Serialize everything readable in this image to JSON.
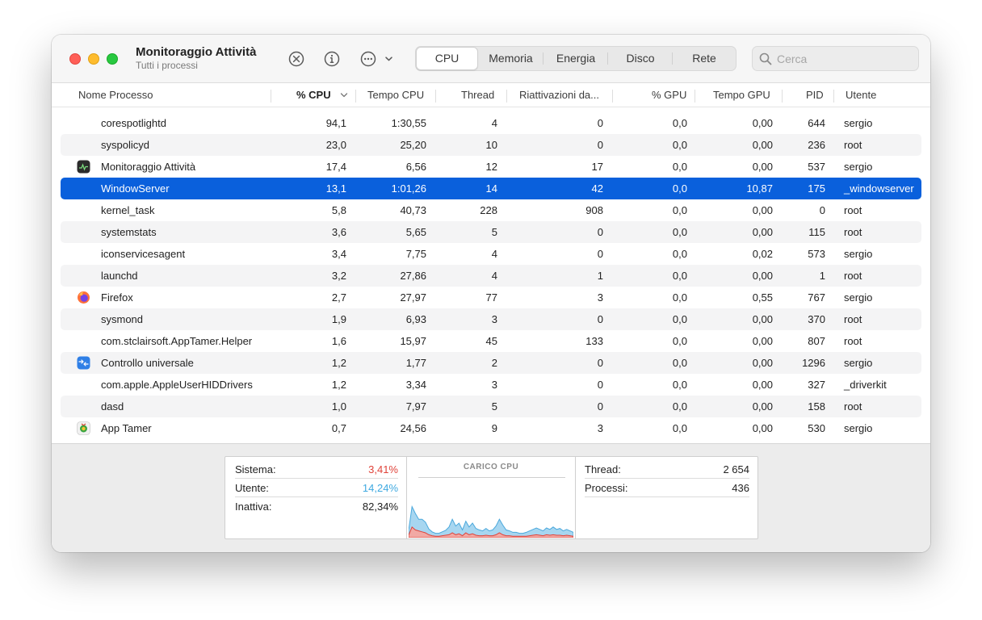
{
  "window": {
    "title": "Monitoraggio Attività",
    "subtitle": "Tutti i processi"
  },
  "toolbar": {
    "icons": [
      "stop-process-icon",
      "info-icon",
      "more-options-icon",
      "chevron-down-icon"
    ],
    "tabs": [
      {
        "label": "CPU",
        "active": true
      },
      {
        "label": "Memoria",
        "active": false
      },
      {
        "label": "Energia",
        "active": false
      },
      {
        "label": "Disco",
        "active": false
      },
      {
        "label": "Rete",
        "active": false
      }
    ],
    "search_placeholder": "Cerca"
  },
  "columns": {
    "name": "Nome Processo",
    "cpu": "% CPU",
    "cpu_time": "Tempo CPU",
    "threads": "Thread",
    "wakeups": "Riattivazioni da...",
    "gpu": "% GPU",
    "gpu_time": "Tempo GPU",
    "pid": "PID",
    "user": "Utente"
  },
  "sort": {
    "column": "% CPU",
    "direction": "descending"
  },
  "processes": [
    {
      "name": "corespotlightd",
      "cpu": "94,1",
      "cpu_time": "1:30,55",
      "threads": "4",
      "wakeups": "0",
      "gpu": "0,0",
      "gpu_time": "0,00",
      "pid": "644",
      "user": "sergio",
      "icon": ""
    },
    {
      "name": "syspolicyd",
      "cpu": "23,0",
      "cpu_time": "25,20",
      "threads": "10",
      "wakeups": "0",
      "gpu": "0,0",
      "gpu_time": "0,00",
      "pid": "236",
      "user": "root",
      "icon": ""
    },
    {
      "name": "Monitoraggio Attività",
      "cpu": "17,4",
      "cpu_time": "6,56",
      "threads": "12",
      "wakeups": "17",
      "gpu": "0,0",
      "gpu_time": "0,00",
      "pid": "537",
      "user": "sergio",
      "icon": "activity-monitor-icon"
    },
    {
      "name": "WindowServer",
      "cpu": "13,1",
      "cpu_time": "1:01,26",
      "threads": "14",
      "wakeups": "42",
      "gpu": "0,0",
      "gpu_time": "10,87",
      "pid": "175",
      "user": "_windowserver",
      "icon": "",
      "selected": true
    },
    {
      "name": "kernel_task",
      "cpu": "5,8",
      "cpu_time": "40,73",
      "threads": "228",
      "wakeups": "908",
      "gpu": "0,0",
      "gpu_time": "0,00",
      "pid": "0",
      "user": "root",
      "icon": ""
    },
    {
      "name": "systemstats",
      "cpu": "3,6",
      "cpu_time": "5,65",
      "threads": "5",
      "wakeups": "0",
      "gpu": "0,0",
      "gpu_time": "0,00",
      "pid": "115",
      "user": "root",
      "icon": ""
    },
    {
      "name": "iconservicesagent",
      "cpu": "3,4",
      "cpu_time": "7,75",
      "threads": "4",
      "wakeups": "0",
      "gpu": "0,0",
      "gpu_time": "0,02",
      "pid": "573",
      "user": "sergio",
      "icon": ""
    },
    {
      "name": "launchd",
      "cpu": "3,2",
      "cpu_time": "27,86",
      "threads": "4",
      "wakeups": "1",
      "gpu": "0,0",
      "gpu_time": "0,00",
      "pid": "1",
      "user": "root",
      "icon": ""
    },
    {
      "name": "Firefox",
      "cpu": "2,7",
      "cpu_time": "27,97",
      "threads": "77",
      "wakeups": "3",
      "gpu": "0,0",
      "gpu_time": "0,55",
      "pid": "767",
      "user": "sergio",
      "icon": "firefox-icon"
    },
    {
      "name": "sysmond",
      "cpu": "1,9",
      "cpu_time": "6,93",
      "threads": "3",
      "wakeups": "0",
      "gpu": "0,0",
      "gpu_time": "0,00",
      "pid": "370",
      "user": "root",
      "icon": ""
    },
    {
      "name": "com.stclairsoft.AppTamer.Helper",
      "cpu": "1,6",
      "cpu_time": "15,97",
      "threads": "45",
      "wakeups": "133",
      "gpu": "0,0",
      "gpu_time": "0,00",
      "pid": "807",
      "user": "root",
      "icon": ""
    },
    {
      "name": "Controllo universale",
      "cpu": "1,2",
      "cpu_time": "1,77",
      "threads": "2",
      "wakeups": "0",
      "gpu": "0,0",
      "gpu_time": "0,00",
      "pid": "1296",
      "user": "sergio",
      "icon": "universal-control-icon"
    },
    {
      "name": "com.apple.AppleUserHIDDrivers",
      "cpu": "1,2",
      "cpu_time": "3,34",
      "threads": "3",
      "wakeups": "0",
      "gpu": "0,0",
      "gpu_time": "0,00",
      "pid": "327",
      "user": "_driverkit",
      "icon": ""
    },
    {
      "name": "dasd",
      "cpu": "1,0",
      "cpu_time": "7,97",
      "threads": "5",
      "wakeups": "0",
      "gpu": "0,0",
      "gpu_time": "0,00",
      "pid": "158",
      "user": "root",
      "icon": ""
    },
    {
      "name": "App Tamer",
      "cpu": "0,7",
      "cpu_time": "24,56",
      "threads": "9",
      "wakeups": "3",
      "gpu": "0,0",
      "gpu_time": "0,00",
      "pid": "530",
      "user": "sergio",
      "icon": "app-tamer-icon"
    }
  ],
  "summary": {
    "system_label": "Sistema:",
    "system_value": "3,41%",
    "user_label": "Utente:",
    "user_value": "14,24%",
    "idle_label": "Inattiva:",
    "idle_value": "82,34%",
    "chart_title": "CARICO CPU",
    "threads_label": "Thread:",
    "threads_value": "2 654",
    "processes_label": "Processi:",
    "processes_value": "436"
  },
  "colors": {
    "selection": "#0a60dc",
    "system": "#e0433a",
    "user": "#3fa9e0"
  },
  "cpu_load_history": {
    "user": [
      0.1,
      0.42,
      0.34,
      0.24,
      0.26,
      0.22,
      0.12,
      0.08,
      0.06,
      0.06,
      0.08,
      0.1,
      0.16,
      0.28,
      0.18,
      0.22,
      0.12,
      0.24,
      0.16,
      0.22,
      0.14,
      0.12,
      0.1,
      0.14,
      0.1,
      0.12,
      0.18,
      0.28,
      0.2,
      0.12,
      0.1,
      0.08,
      0.08,
      0.06,
      0.06,
      0.08,
      0.1,
      0.12,
      0.14,
      0.12,
      0.1,
      0.14,
      0.12,
      0.16,
      0.12,
      0.14,
      0.1,
      0.12,
      0.1,
      0.08
    ],
    "system": [
      0.05,
      0.22,
      0.16,
      0.14,
      0.12,
      0.1,
      0.06,
      0.04,
      0.03,
      0.03,
      0.04,
      0.05,
      0.06,
      0.1,
      0.06,
      0.08,
      0.04,
      0.1,
      0.06,
      0.08,
      0.05,
      0.04,
      0.04,
      0.05,
      0.04,
      0.04,
      0.06,
      0.1,
      0.06,
      0.04,
      0.04,
      0.03,
      0.03,
      0.03,
      0.03,
      0.03,
      0.04,
      0.05,
      0.06,
      0.05,
      0.04,
      0.06,
      0.05,
      0.06,
      0.05,
      0.05,
      0.04,
      0.05,
      0.04,
      0.03
    ]
  }
}
